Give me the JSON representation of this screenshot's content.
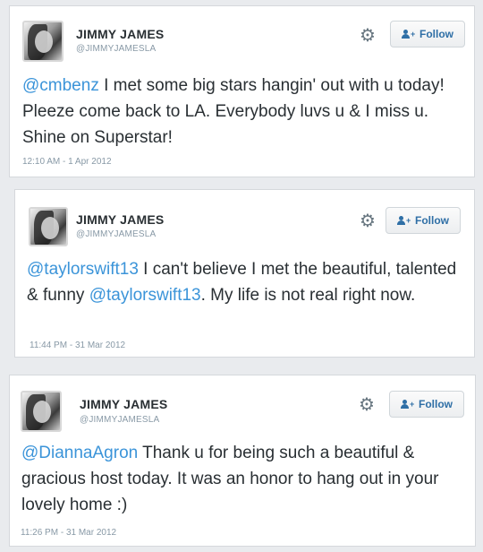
{
  "tweets": [
    {
      "name": "JIMMY JAMES",
      "handle": "@JIMMYJAMESLA",
      "follow_label": "Follow",
      "text": [
        {
          "t": "@cmbenz",
          "mention": true
        },
        {
          "t": " I met some big stars hangin' out with u today! Pleeze come back to LA. Everybody luvs u & I miss u. Shine on Superstar!",
          "mention": false
        }
      ],
      "timestamp": "12:10 AM - 1 Apr 2012"
    },
    {
      "name": "JIMMY JAMES",
      "handle": "@JIMMYJAMESLA",
      "follow_label": "Follow",
      "text": [
        {
          "t": "@taylorswift13",
          "mention": true
        },
        {
          "t": " I can't believe I met the beautiful, talented & funny ",
          "mention": false
        },
        {
          "t": "@taylorswift13",
          "mention": true
        },
        {
          "t": ". My life is not real right now.",
          "mention": false
        }
      ],
      "timestamp": "11:44 PM - 31 Mar 2012"
    },
    {
      "name": "JIMMY JAMES",
      "handle": "@JIMMYJAMESLA",
      "follow_label": "Follow",
      "text": [
        {
          "t": "@DiannaAgron",
          "mention": true
        },
        {
          "t": " Thank u for being such a beautiful & gracious host today. It was an honor to hang out in your lovely home :)",
          "mention": false
        }
      ],
      "timestamp": "11:26 PM - 31 Mar 2012"
    }
  ],
  "icons": {
    "avatar": "profile-photo",
    "gear": "gear-icon",
    "follow": "add-person-icon"
  },
  "colors": {
    "mention": "#3b94d9",
    "muted": "#8899a6",
    "follow_text": "#2f6fa6"
  }
}
